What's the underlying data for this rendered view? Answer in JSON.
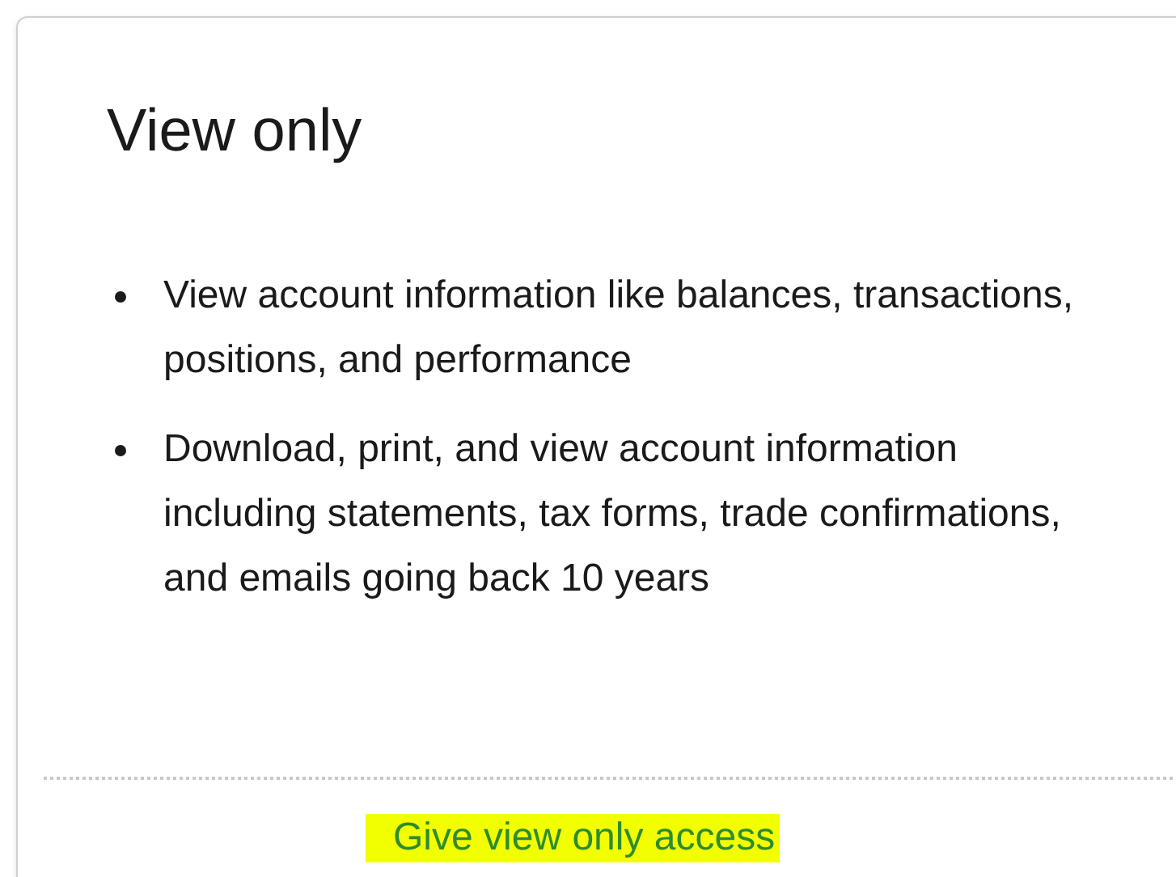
{
  "card": {
    "title": "View only",
    "bullets": [
      "View account information like balances, transactions, positions, and performance",
      "Download, print, and view account information including statements, tax forms, trade confirmations, and emails going back 10 years"
    ],
    "action": {
      "label": "Give view only access",
      "highlighted": true
    }
  }
}
